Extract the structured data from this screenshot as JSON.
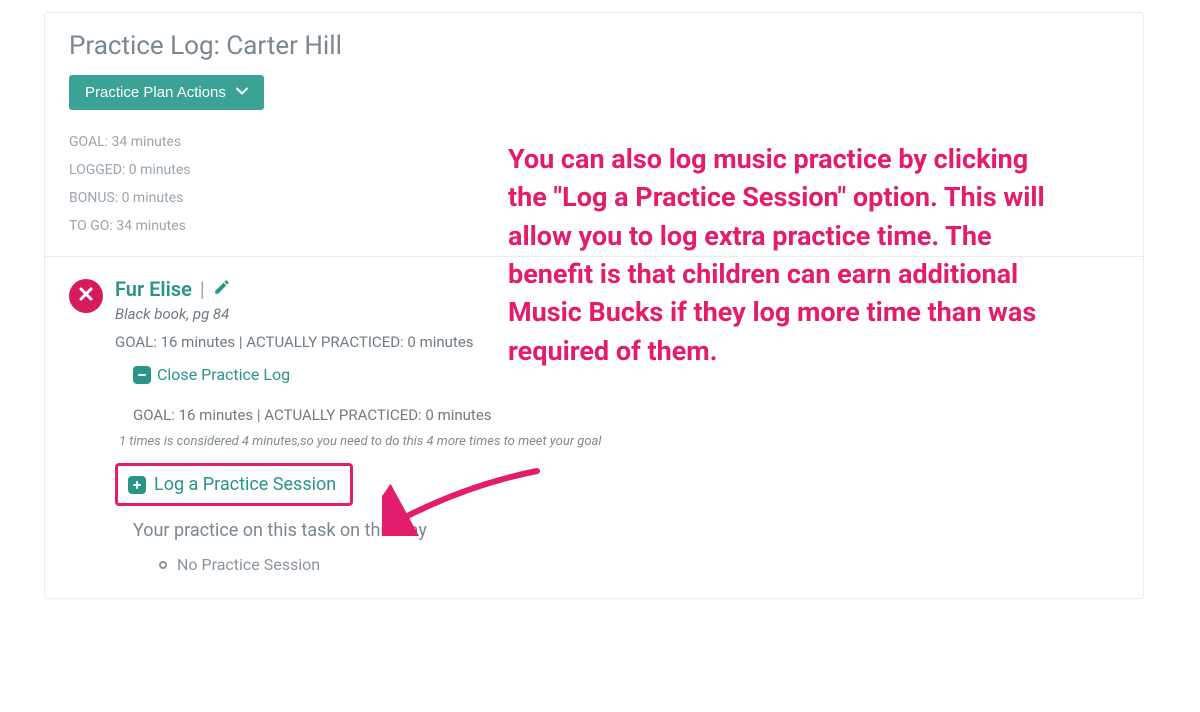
{
  "header": {
    "title": "Practice Log: Carter Hill",
    "actions_label": "Practice Plan Actions"
  },
  "stats": {
    "goal_label": "GOAL: 34 minutes",
    "logged_label": "LOGGED: 0 minutes",
    "bonus_label": "BONUS: 0 minutes",
    "togo_label": "TO GO: 34 minutes"
  },
  "task": {
    "title": "Fur Elise",
    "pipe": " | ",
    "subtitle": "Black book, pg 84",
    "goal_line": "GOAL: 16 minutes | ACTUALLY PRACTICED: 0 minutes",
    "close_log_label": "Close Practice Log",
    "inner_goal_line": "GOAL: 16 minutes | ACTUALLY PRACTICED: 0 minutes",
    "hint": "1 times is considered 4 minutes,so you need to do this 4 more times to meet your goal",
    "log_session_label": "Log a Practice Session",
    "day_heading": "Your practice on this task on this day",
    "no_session": "No Practice Session"
  },
  "annotation": {
    "text": "You can also log music practice by clicking the \"Log a Practice Session\" option. This will allow you to log extra practice time. The benefit is that children can earn additional Music Bucks if they log more time than was required of them."
  },
  "colors": {
    "teal": "#2b9488",
    "teal_btn": "#3aa396",
    "pink": "#e31c6b",
    "magenta_badge": "#d61a5e",
    "muted": "#8a949c"
  }
}
